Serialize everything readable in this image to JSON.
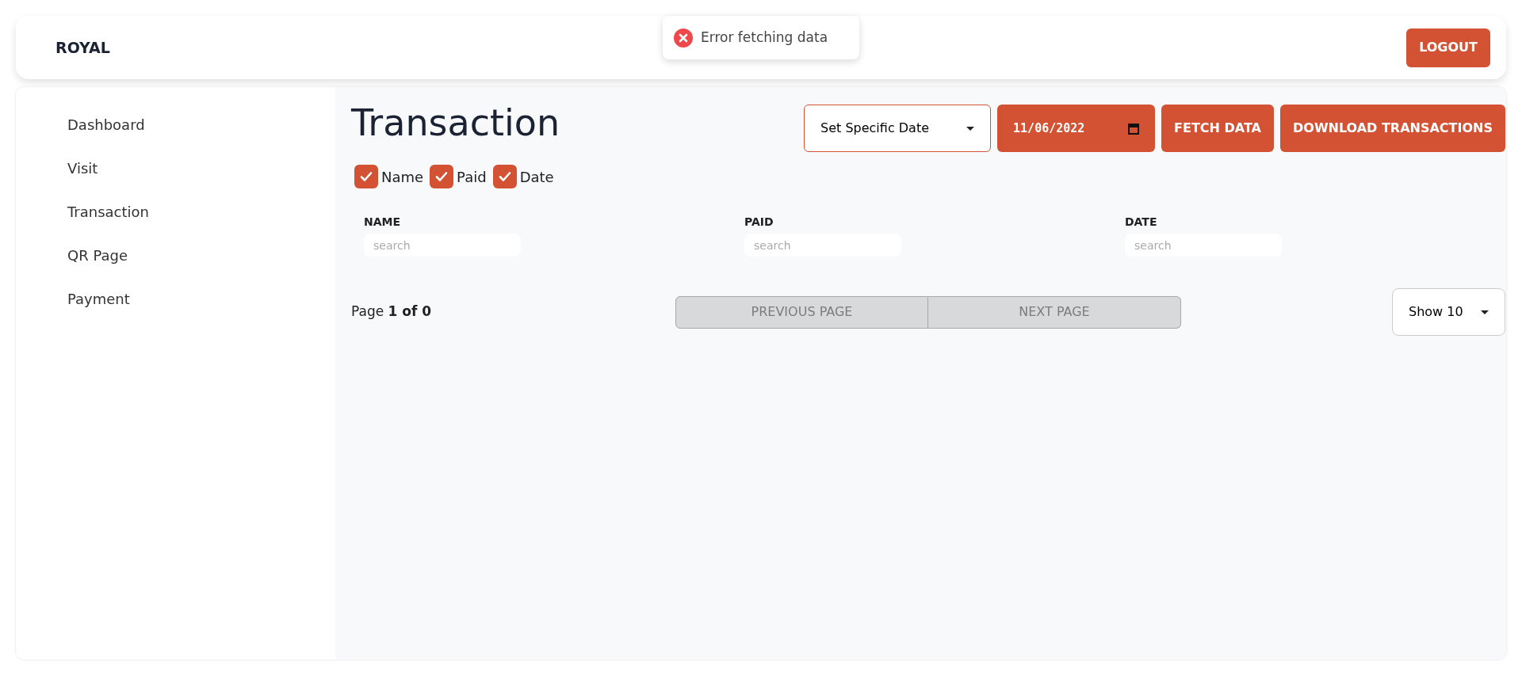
{
  "brand": "ROYAL",
  "toast": {
    "kind": "error",
    "message": "Error fetching data"
  },
  "logout": "LOGOUT",
  "sidebar": {
    "items": [
      {
        "label": "Dashboard",
        "selected": false
      },
      {
        "label": "Visit",
        "selected": false
      },
      {
        "label": "Transaction",
        "selected": false
      },
      {
        "label": "QR Page",
        "selected": false
      },
      {
        "label": "Payment",
        "selected": false
      }
    ]
  },
  "title": "Transaction",
  "date_mode": "Set Specific Date",
  "date_value": "11/06/2022",
  "buttons": [
    "FETCH DATA",
    "DOWNLOAD TRANSACTIONS"
  ],
  "column_toggles": [
    {
      "label": "Name",
      "checked": true
    },
    {
      "label": "Paid",
      "checked": true
    },
    {
      "label": "Date",
      "checked": true
    }
  ],
  "columns": [
    {
      "header": "NAME",
      "placeholder": "search"
    },
    {
      "header": "PAID",
      "placeholder": "search"
    },
    {
      "header": "DATE",
      "placeholder": "search"
    }
  ],
  "pagination": {
    "prefix": "Page",
    "position": "1 of 0",
    "previous": {
      "label": "PREVIOUS PAGE",
      "disabled": true
    },
    "next": {
      "label": "NEXT PAGE",
      "disabled": true
    },
    "page_size": "Show 10"
  }
}
